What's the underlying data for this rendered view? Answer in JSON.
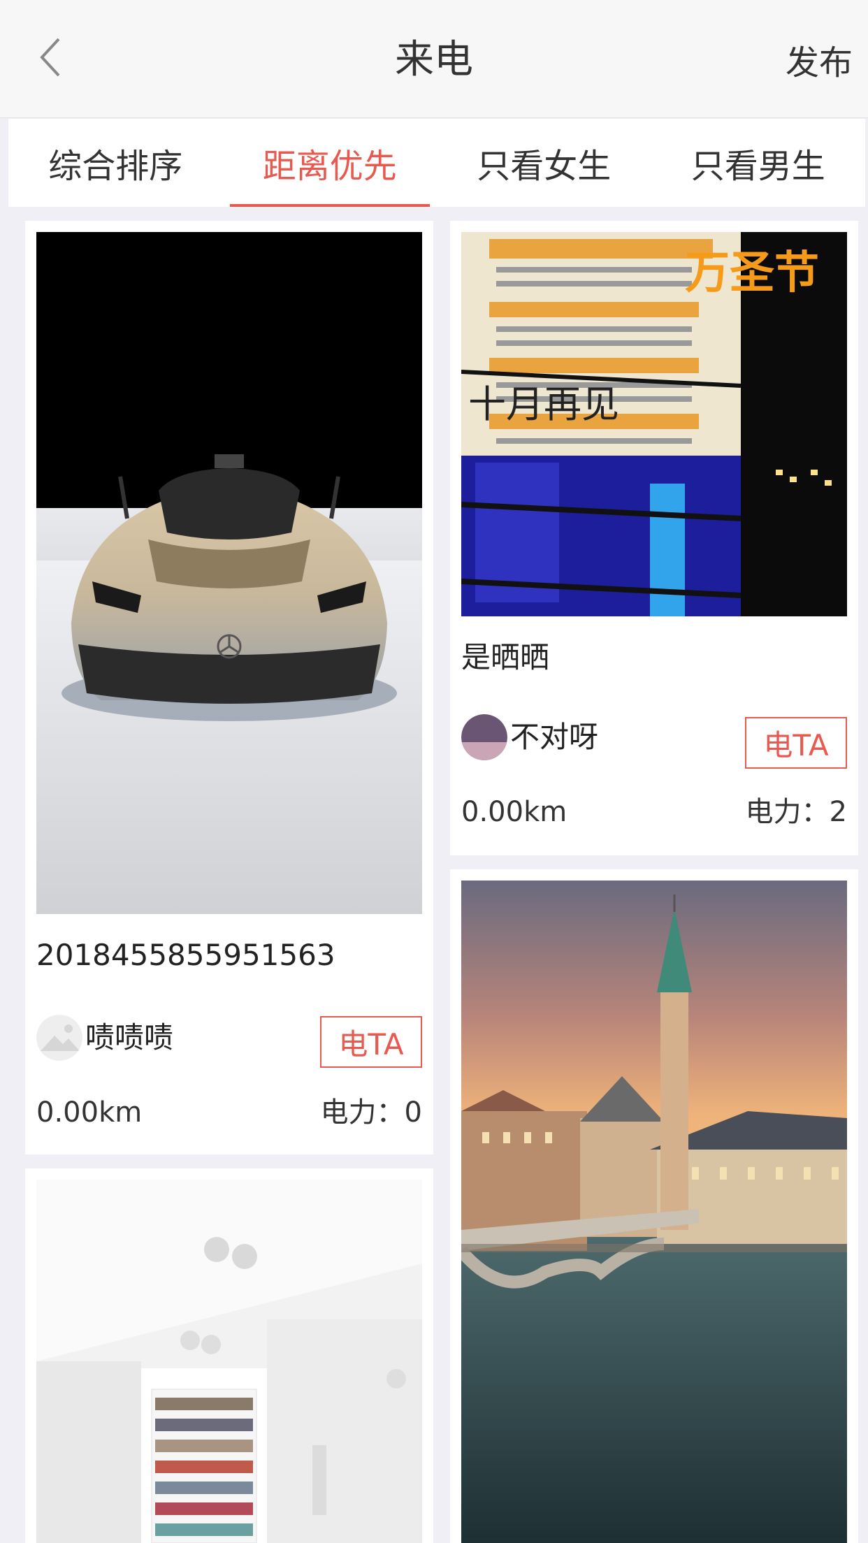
{
  "header": {
    "title": "来电",
    "publish_label": "发布",
    "back_icon": "chevron-left-icon"
  },
  "tabs": [
    {
      "label": "综合排序",
      "active": false
    },
    {
      "label": "距离优先",
      "active": true
    },
    {
      "label": "只看女生",
      "active": false
    },
    {
      "label": "只看男生",
      "active": false
    }
  ],
  "colors": {
    "accent": "#e85a4f",
    "background": "#f0eff5"
  },
  "cards": [
    {
      "image": "silver-sports-car-photo",
      "caption": "2018455855951563",
      "author": "啧啧啧",
      "call_label": "电TA",
      "distance": "0.00km",
      "power": "电力：0"
    },
    {
      "image": "halloween-bus-station-sign-photo",
      "image_overlay_text": "万圣节",
      "image_overlay_text2": "十月再见",
      "caption": "是晒晒",
      "author": "不对呀",
      "call_label": "电TA",
      "distance": "0.00km",
      "power": "电力：2"
    },
    {
      "image": "white-room-shoe-shelf-photo"
    },
    {
      "image": "european-church-river-bridge-photo"
    }
  ]
}
